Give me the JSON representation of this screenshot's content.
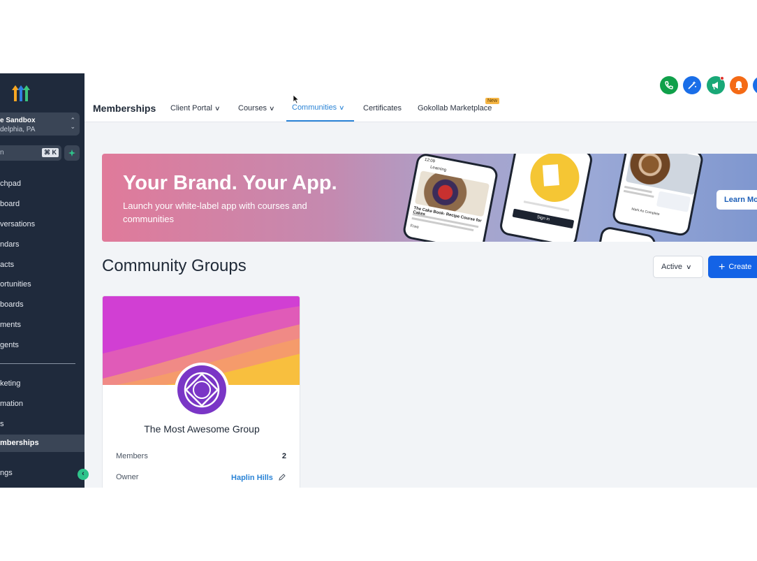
{
  "sidebar": {
    "account": {
      "name": "e Sandbox",
      "location": "delphia, PA"
    },
    "search": {
      "placeholder": "n",
      "shortcut": "⌘ K"
    },
    "items": [
      {
        "label": "chpad"
      },
      {
        "label": "board"
      },
      {
        "label": "versations"
      },
      {
        "label": "ndars"
      },
      {
        "label": "acts"
      },
      {
        "label": "ortunities"
      },
      {
        "label": "boards"
      },
      {
        "label": "ments"
      },
      {
        "label": "gents"
      },
      {
        "label": "keting"
      },
      {
        "label": "mation"
      },
      {
        "label": "s"
      },
      {
        "label": "mberships"
      },
      {
        "label": "ngs"
      }
    ]
  },
  "header": {
    "title": "Memberships",
    "tabs": [
      {
        "label": "Client Portal"
      },
      {
        "label": "Courses"
      },
      {
        "label": "Communities"
      },
      {
        "label": "Certificates"
      },
      {
        "label": "Gokollab Marketplace"
      }
    ],
    "new_badge": "New",
    "colors": {
      "phone": "#10a04a",
      "ai": "#1a6ee8",
      "megaphone": "#19a877",
      "bell": "#f46a15"
    }
  },
  "banner": {
    "heading": "Your Brand. Your App.",
    "subtext": "Launch your white-label app with courses and communities",
    "learn_more": "Learn Mo",
    "phone1": {
      "time": "12:09",
      "title": "Learning",
      "caption": "The Cake Book- Recipe Course for Cakes",
      "tag": "Free"
    },
    "phone2": {
      "button": "Sign in"
    },
    "phone3": {
      "action": "Mark As Complete"
    }
  },
  "section": {
    "title": "Community Groups",
    "filter": "Active",
    "create": "Create"
  },
  "group_card": {
    "name": "The Most Awesome Group",
    "members_label": "Members",
    "members_value": "2",
    "owner_label": "Owner",
    "owner_value": "Haplin Hills"
  },
  "colors": {
    "accent": "#1463e6",
    "sidebar": "#1f2a3c",
    "tab_active": "#2b84d6"
  }
}
